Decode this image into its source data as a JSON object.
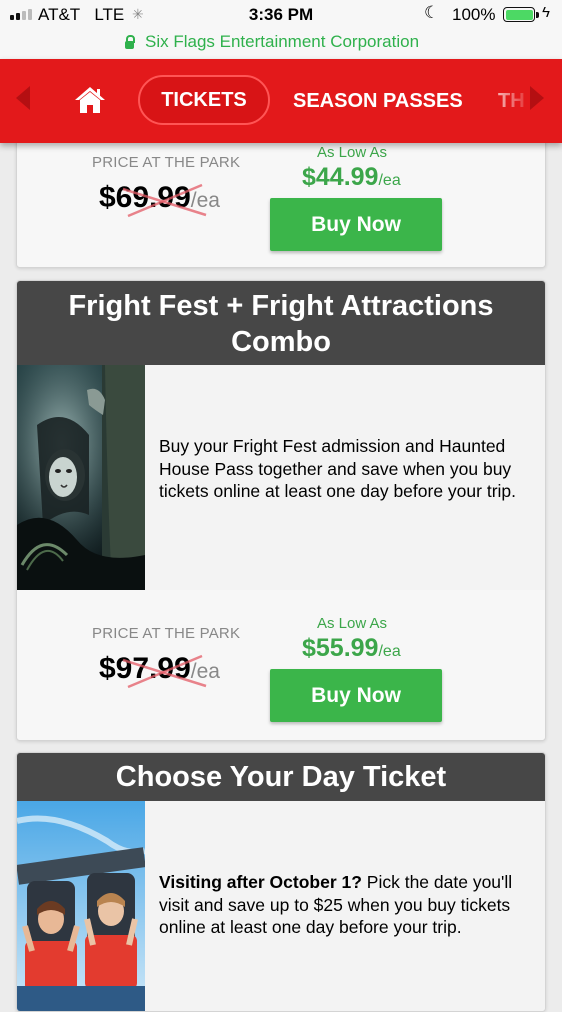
{
  "status_bar": {
    "carrier": "AT&T",
    "network": "LTE",
    "time": "3:36 PM",
    "battery_percent": "100%"
  },
  "url_bar": {
    "site_name": "Six Flags Entertainment Corporation"
  },
  "nav": {
    "items": [
      "TICKETS",
      "SEASON PASSES",
      "TH"
    ],
    "active": "TICKETS"
  },
  "cards": [
    {
      "at_park_label": "PRICE AT THE PARK",
      "old_price": "$69.99",
      "old_unit": "/ea",
      "low_label": "As Low As",
      "new_price": "$44.99",
      "new_unit": "/ea",
      "buy_label": "Buy Now"
    },
    {
      "title": "Fright Fest + Fright Attractions Combo",
      "description": "Buy your Fright Fest admission and Haunted House Pass together and save when you buy tickets online at least one day before your trip.",
      "at_park_label": "PRICE AT THE PARK",
      "old_price": "$97.99",
      "old_unit": "/ea",
      "low_label": "As Low As",
      "new_price": "$55.99",
      "new_unit": "/ea",
      "buy_label": "Buy Now"
    },
    {
      "title": "Choose Your Day Ticket",
      "description_bold": "Visiting after October 1?",
      "description": " Pick the date you'll visit and save up to $25 when you buy tickets online at least one day before your trip."
    }
  ],
  "colors": {
    "brand_red": "#e3191b",
    "header_gray": "#474747",
    "price_green": "#3ca64a",
    "button_green": "#3bb54a"
  }
}
